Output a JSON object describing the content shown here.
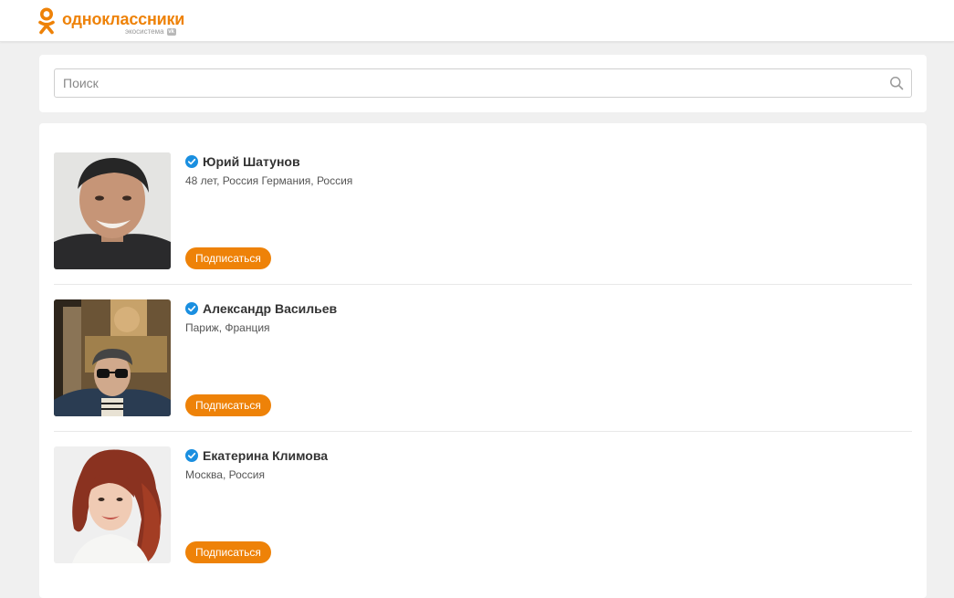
{
  "header": {
    "logo_text": "одноклассники",
    "logo_sub": "экосистема",
    "vk_badge": "vk"
  },
  "search": {
    "placeholder": "Поиск",
    "value": ""
  },
  "colors": {
    "brand_orange": "#ee8208",
    "verified_blue": "#1a8fe0"
  },
  "results": [
    {
      "name": "Юрий Шатунов",
      "meta": "48 лет, Россия Германия, Россия",
      "button_label": "Подписаться",
      "verified": true
    },
    {
      "name": "Александр Васильев",
      "meta": "Париж, Франция",
      "button_label": "Подписаться",
      "verified": true
    },
    {
      "name": "Екатерина Климова",
      "meta": "Москва, Россия",
      "button_label": "Подписаться",
      "verified": true
    }
  ]
}
